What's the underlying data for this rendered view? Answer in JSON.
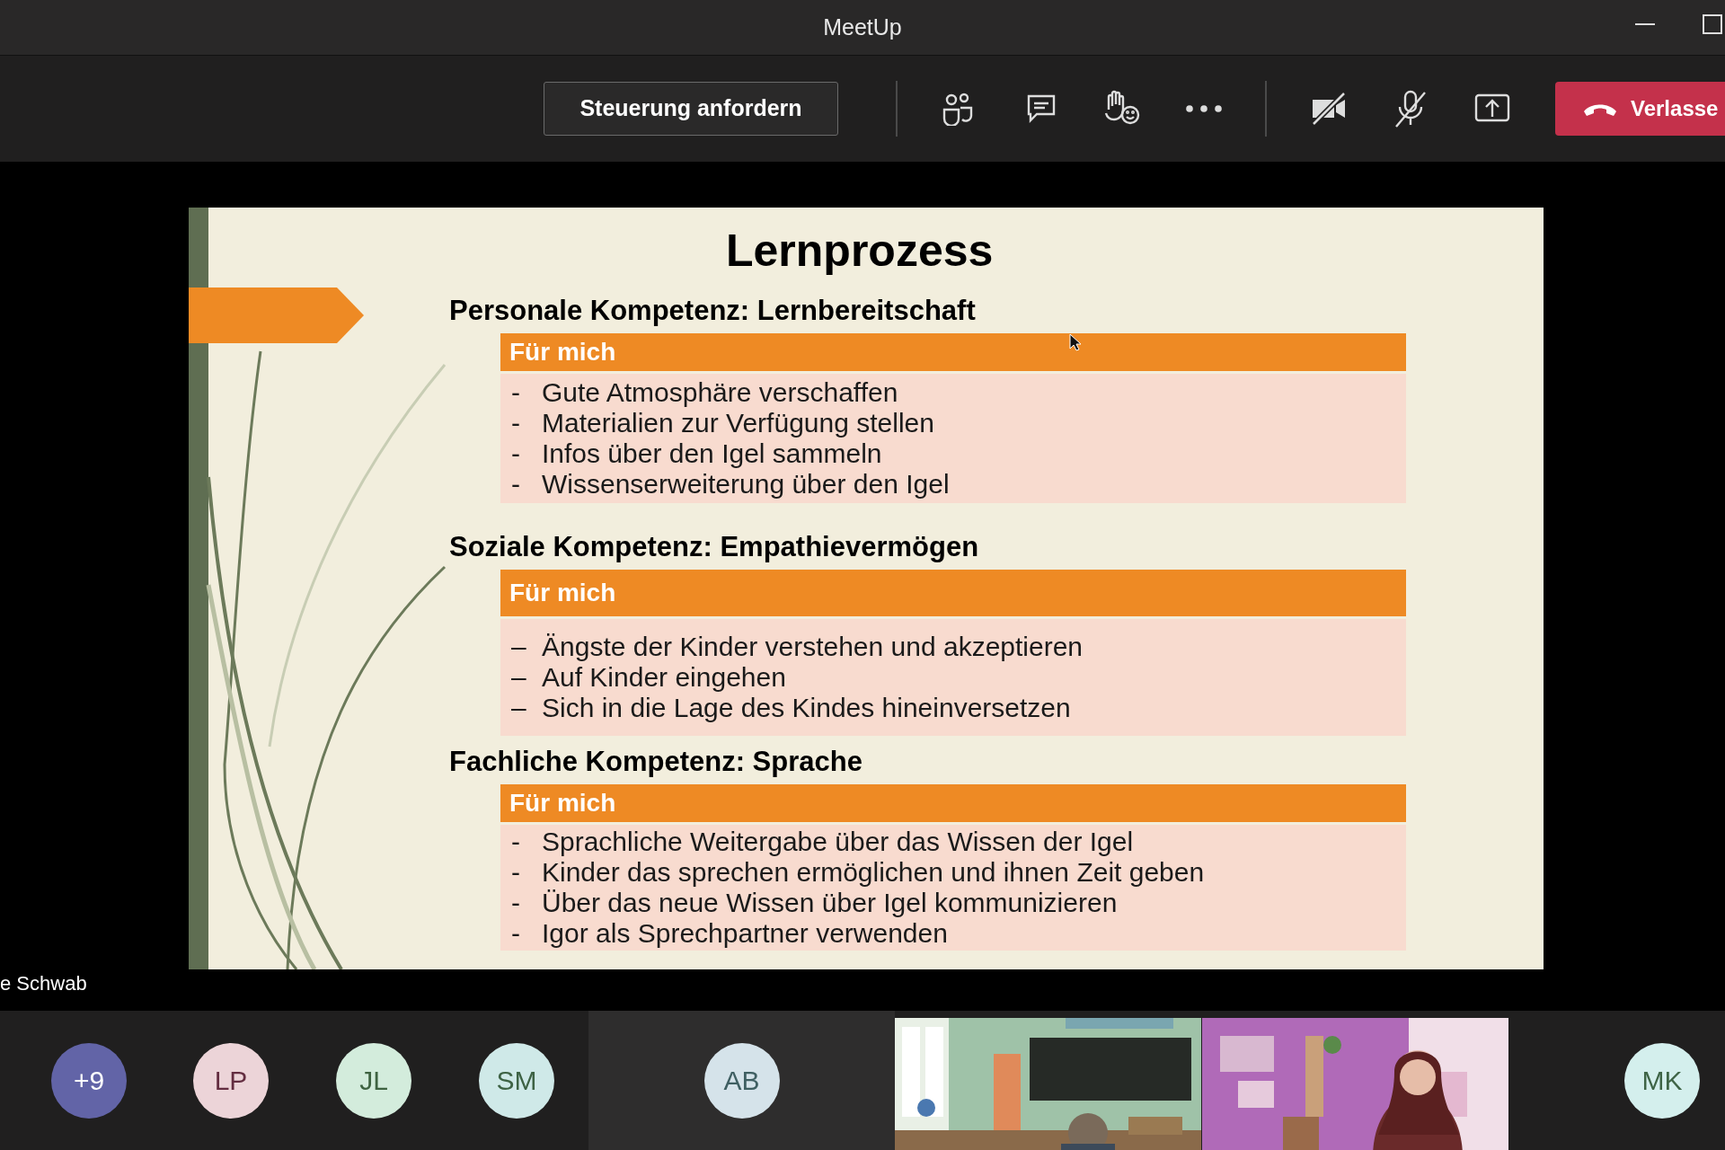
{
  "window": {
    "title": "MeetUp"
  },
  "toolbar": {
    "control_button": "Steuerung anfordern",
    "leave_button": "Verlasse"
  },
  "slide": {
    "title": "Lernprozess",
    "sections": [
      {
        "heading": "Personale Kompetenz: Lernbereitschaft",
        "box_header": "Für mich",
        "items": [
          {
            "dash": "-",
            "text": "Gute Atmosphäre verschaffen"
          },
          {
            "dash": "-",
            "text": "Materialien zur Verfügung stellen"
          },
          {
            "dash": "-",
            "text": "Infos über den Igel sammeln"
          },
          {
            "dash": "-",
            "text": "Wissenserweiterung über den Igel"
          }
        ]
      },
      {
        "heading": "Soziale Kompetenz: Empathievermögen",
        "box_header": "Für mich",
        "items": [
          {
            "dash": "–",
            "text": "Ängste der Kinder verstehen und akzeptieren"
          },
          {
            "dash": "–",
            "text": "Auf Kinder eingehen"
          },
          {
            "dash": "–",
            "text": "Sich in die Lage des Kindes hineinversetzen"
          }
        ]
      },
      {
        "heading": "Fachliche Kompetenz: Sprache",
        "box_header": "Für mich",
        "items": [
          {
            "dash": "-",
            "text": "Sprachliche Weitergabe über das Wissen der Igel"
          },
          {
            "dash": "-",
            "text": "Kinder das sprechen ermöglichen und ihnen Zeit geben"
          },
          {
            "dash": "-",
            "text": "Über das neue Wissen über Igel kommunizieren"
          },
          {
            "dash": "-",
            "text": "Igor als Sprechpartner verwenden"
          }
        ]
      }
    ]
  },
  "presenter_name": "e Schwab",
  "participants": [
    {
      "kind": "avatar",
      "initials": "+9",
      "color": "#6264a7",
      "highlighted": false
    },
    {
      "kind": "avatar",
      "initials": "LP",
      "color": "#ecd4d8",
      "highlighted": false
    },
    {
      "kind": "avatar",
      "initials": "JL",
      "color": "#d3ecdc",
      "highlighted": false
    },
    {
      "kind": "avatar",
      "initials": "SM",
      "color": "#cfe9e8",
      "highlighted": false
    },
    {
      "kind": "avatar",
      "initials": "AB",
      "color": "#d5e3ea",
      "highlighted": true
    },
    {
      "kind": "picture"
    },
    {
      "kind": "picture"
    },
    {
      "kind": "avatar",
      "initials": "MK",
      "color": "#d4efed",
      "highlighted": false
    }
  ]
}
